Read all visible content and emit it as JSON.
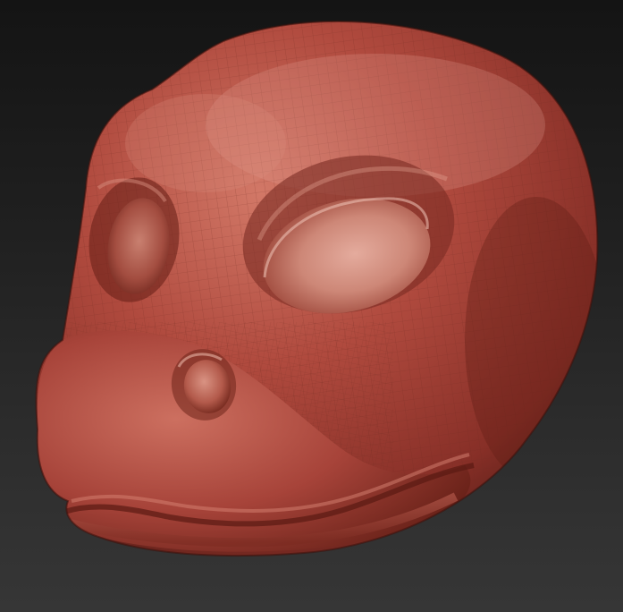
{
  "scene": {
    "subject": "sculpted-creature-head",
    "material": "red-wax",
    "colors": {
      "background_top": "#141414",
      "background_bottom": "#363636",
      "clay_base": "#b04a3e",
      "clay_highlight": "#e8b5a8",
      "clay_shadow": "#4a1812",
      "wireframe": "#6d2a22"
    }
  }
}
